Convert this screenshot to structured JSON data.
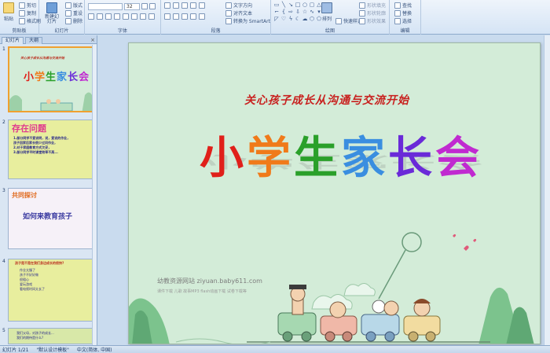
{
  "ribbon": {
    "clipboard": {
      "paste": "粘贴",
      "cut": "剪切",
      "copy": "复制",
      "format_painter": "格式刷",
      "label": "剪贴板"
    },
    "slides": {
      "new_slide": "新建幻灯片",
      "layout": "版式",
      "reset": "重设",
      "delete": "删除",
      "label": "幻灯片"
    },
    "font": {
      "font_size": "32",
      "label": "字体"
    },
    "paragraph": {
      "text_direction": "文字方向",
      "align_text": "对齐文本",
      "smartart": "转换为 SmartArt",
      "label": "段落"
    },
    "drawing": {
      "arrange": "排列",
      "quick_styles": "快速样式",
      "shape_fill": "形状填充",
      "shape_outline": "形状轮廓",
      "shape_effects": "形状效果",
      "label": "绘图"
    },
    "editing": {
      "find": "查找",
      "replace": "替换",
      "select": "选择",
      "label": "编辑"
    }
  },
  "left_pane": {
    "tabs": [
      "幻灯片",
      "大纲"
    ],
    "thumbs": [
      {
        "num": "1",
        "subtitle": "关心孩子成长从沟通与交流开始",
        "title": "小学生家长会"
      },
      {
        "num": "2",
        "heading": "存在问题",
        "lines": [
          "1.部分同学不爱说明，说，爱说的作业，",
          "孩子回家后家长很少过问作业，",
          "2.对于家庭教育方式欠妥，",
          "3.部分同学平时课堂效率不高..."
        ]
      },
      {
        "num": "3",
        "heading": "共同探讨",
        "title": "如何来教育孩子"
      },
      {
        "num": "4",
        "heading": "孩子是不是在我们身边成长的很快?",
        "lines": [
          "作业太慢了",
          "孩子不好好做",
          "很粗心",
          "爱玩游戏",
          "看电视时间太长了"
        ]
      },
      {
        "num": "5",
        "lines": [
          "我们父母，对孩子的成长...",
          "我们的期待是什么?"
        ]
      }
    ]
  },
  "slide": {
    "subtitle": "关心孩子成长从沟通与交流开始",
    "title_chars": [
      "小",
      "学",
      "生",
      "家",
      "长",
      "会"
    ],
    "title_colors": [
      "#e0201a",
      "#f07a1a",
      "#2aa02a",
      "#3a8ee0",
      "#6a2ad8",
      "#c02ad0"
    ],
    "watermark": "幼教资源网站 ziyuan.baby611.com",
    "watermark_small": "课件下载 儿歌 故事MP3 flash动画下载 试卷下载等"
  },
  "status": {
    "slide_info": "幻灯片 1/21",
    "theme": "\"默认设计模板\"",
    "language": "中文(简体, 中国)"
  }
}
